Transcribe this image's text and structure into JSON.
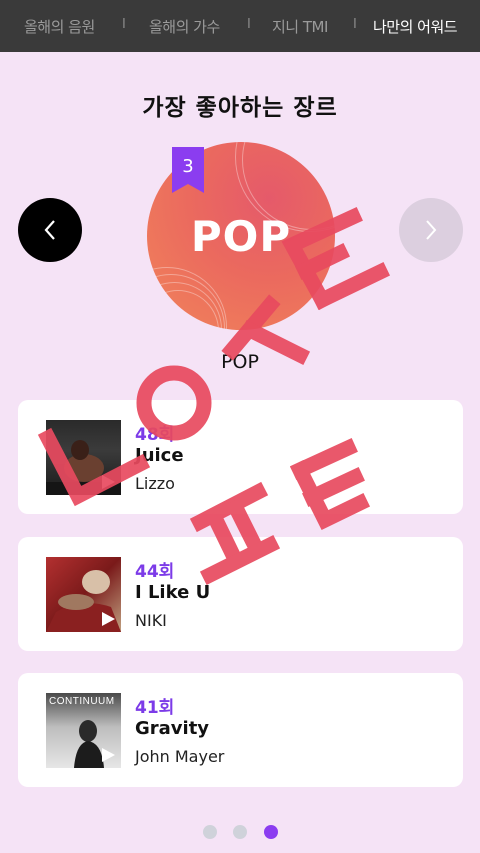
{
  "topnav": {
    "tabs": [
      {
        "label": "올해의 음원",
        "active": false
      },
      {
        "label": "올해의 가수",
        "active": false
      },
      {
        "label": "지니 TMI",
        "active": false
      },
      {
        "label": "나만의 어워드",
        "active": true
      }
    ],
    "separator": "I"
  },
  "section_title": "가장 좋아하는 장르",
  "genre": {
    "rank": "3",
    "cover_label": "POP",
    "name": "POP"
  },
  "songs": [
    {
      "count": "48회",
      "title": "Juice",
      "artist": "Lizzo"
    },
    {
      "count": "44회",
      "title": "I Like U",
      "artist": "NIKI"
    },
    {
      "count": "41회",
      "title": "Gravity",
      "artist": "John Mayer",
      "cover_text": "CONTINUUM"
    }
  ],
  "overlay_text": [
    "ㄴ",
    "ㅇ",
    "ㅅ",
    "ㅌ",
    "ㅍ",
    "ㅌ"
  ],
  "pagination": {
    "total": 3,
    "active_index": 2
  },
  "colors": {
    "accent": "#7c3be8",
    "background": "#f5e3f6",
    "nav_bg": "#3a3a3a",
    "overlay": "#e84a5f"
  }
}
